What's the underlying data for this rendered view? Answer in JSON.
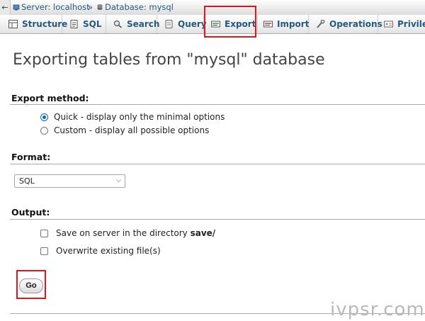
{
  "breadcrumb": {
    "server": "Server: localhost",
    "separator": "»",
    "database": "Database: mysql"
  },
  "tabs": [
    {
      "label": "Structure",
      "icon": "structure-icon"
    },
    {
      "label": "SQL",
      "icon": "sql-icon"
    },
    {
      "label": "Search",
      "icon": "search-icon"
    },
    {
      "label": "Query",
      "icon": "query-icon"
    },
    {
      "label": "Export",
      "icon": "export-icon"
    },
    {
      "label": "Import",
      "icon": "import-icon"
    },
    {
      "label": "Operations",
      "icon": "operations-icon"
    },
    {
      "label": "Privileges",
      "icon": "privileges-icon"
    }
  ],
  "page": {
    "title": "Exporting tables from \"mysql\" database"
  },
  "export_method": {
    "heading": "Export method:",
    "options": [
      {
        "label": "Quick - display only the minimal options",
        "selected": true
      },
      {
        "label": "Custom - display all possible options",
        "selected": false
      }
    ]
  },
  "format": {
    "heading": "Format:",
    "selected": "SQL"
  },
  "output": {
    "heading": "Output:",
    "save_label_prefix": "Save on server in the directory",
    "save_dir": "save/",
    "save_checked": false,
    "overwrite_label": "Overwrite existing file(s)",
    "overwrite_checked": false
  },
  "actions": {
    "go_label": "Go"
  },
  "watermark": "ivpsr.com",
  "colors": {
    "link": "#235a81",
    "highlight": "#e0151a",
    "radio_selected": "#0a64d6"
  }
}
